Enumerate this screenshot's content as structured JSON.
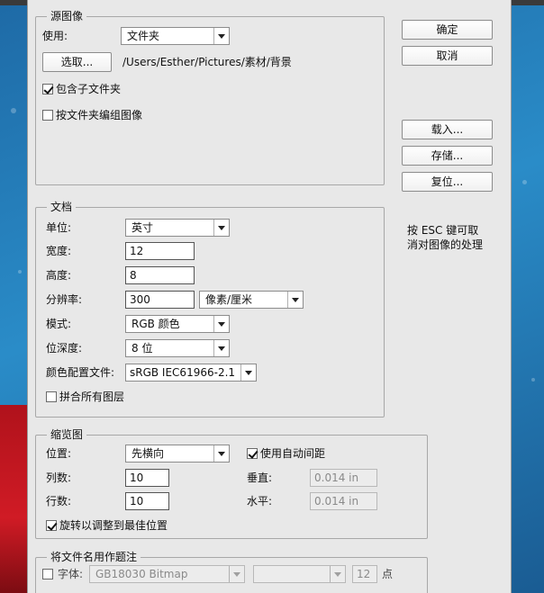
{
  "source": {
    "legend": "源图像",
    "use_label": "使用:",
    "use_value": "文件夹",
    "choose_button": "选取...",
    "path": "/Users/Esther/Pictures/素材/背景",
    "include_subfolders_label": "包含子文件夹",
    "include_subfolders_checked": true,
    "group_by_folder_label": "按文件夹编组图像",
    "group_by_folder_checked": false
  },
  "actions": {
    "ok": "确定",
    "cancel": "取消",
    "load": "载入...",
    "save": "存储...",
    "reset": "复位...",
    "esc_note_line1": "按 ESC 键可取",
    "esc_note_line2": "消对图像的处理"
  },
  "document": {
    "legend": "文档",
    "unit_label": "单位:",
    "unit_value": "英寸",
    "width_label": "宽度:",
    "width_value": "12",
    "height_label": "高度:",
    "height_value": "8",
    "resolution_label": "分辨率:",
    "resolution_value": "300",
    "resolution_unit": "像素/厘米",
    "mode_label": "模式:",
    "mode_value": "RGB 颜色",
    "depth_label": "位深度:",
    "depth_value": "8 位",
    "profile_label": "颜色配置文件:",
    "profile_value": "sRGB IEC61966-2.1",
    "flatten_label": "拼合所有图层",
    "flatten_checked": false
  },
  "thumbnails": {
    "legend": "缩览图",
    "position_label": "位置:",
    "position_value": "先横向",
    "auto_spacing_label": "使用自动间距",
    "auto_spacing_checked": true,
    "columns_label": "列数:",
    "columns_value": "10",
    "rows_label": "行数:",
    "rows_value": "10",
    "vertical_label": "垂直:",
    "vertical_value": "0.014 in",
    "horizontal_label": "水平:",
    "horizontal_value": "0.014 in",
    "rotate_label": "旋转以调整到最佳位置",
    "rotate_checked": true
  },
  "caption": {
    "legend": "将文件名用作题注",
    "font_label": "字体:",
    "font_checked": false,
    "font_family_value": "GB18030 Bitmap",
    "font_style_value": "",
    "font_size_value": "12",
    "font_size_unit": "点"
  },
  "colors": {
    "dialog_bg": "#e8e8e8",
    "background_blue": "#2a8cc8",
    "background_red": "#d01b25"
  }
}
